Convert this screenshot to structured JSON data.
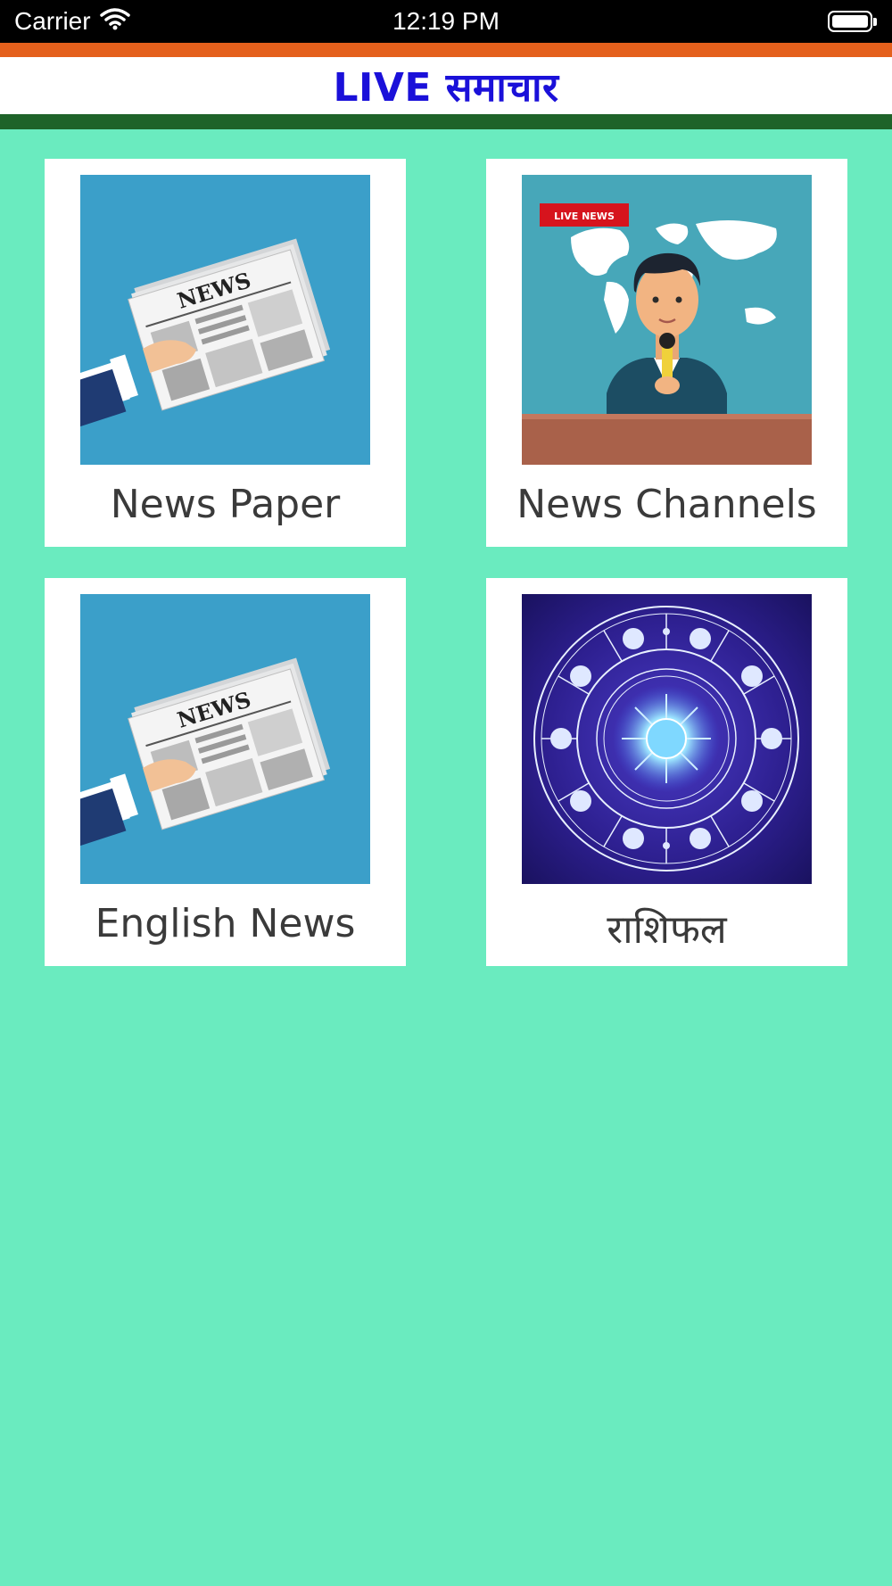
{
  "status_bar": {
    "carrier": "Carrier",
    "time": "12:19 PM",
    "wifi_icon": "wifi-icon",
    "battery_icon": "battery-icon"
  },
  "header": {
    "title": "LIVE समाचार",
    "colors": {
      "top_stripe": "#e4601c",
      "background": "#ffffff",
      "bottom_stripe": "#1e6329",
      "title": "#1a10d9"
    }
  },
  "background_color": "#6aebbf",
  "cards": [
    {
      "label": "News Paper",
      "icon": "newspaper-in-hand-icon"
    },
    {
      "label": "News Channels",
      "icon": "news-anchor-icon",
      "badge": "LIVE NEWS"
    },
    {
      "label": "English News",
      "icon": "newspaper-in-hand-icon"
    },
    {
      "label": "राशिफल",
      "icon": "zodiac-wheel-icon"
    }
  ],
  "newspaper_masthead": "NEWS"
}
